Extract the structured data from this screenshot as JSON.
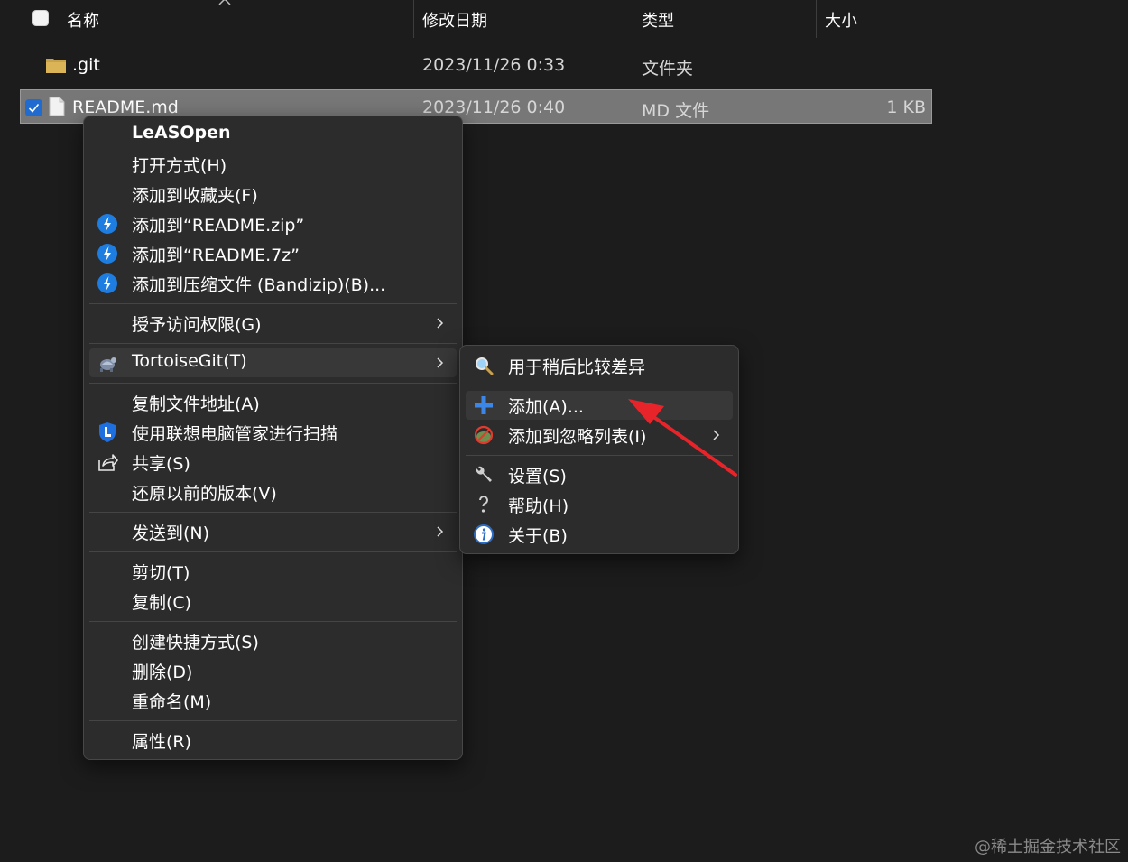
{
  "header": {
    "col_name": "名称",
    "col_date": "修改日期",
    "col_type": "类型",
    "col_size": "大小"
  },
  "files": [
    {
      "name": ".git",
      "date": "2023/11/26 0:33",
      "type": "文件夹",
      "size": ""
    },
    {
      "name": "README.md",
      "date": "2023/11/26 0:40",
      "type": "MD 文件",
      "size": "1 KB"
    }
  ],
  "context_menu": {
    "items": [
      {
        "label": "LeASOpen",
        "icon": ""
      },
      {
        "label": "打开方式(H)",
        "icon": ""
      },
      {
        "label": "添加到收藏夹(F)",
        "icon": ""
      },
      {
        "label": "添加到“README.zip”",
        "icon": "bandizip-icon"
      },
      {
        "label": "添加到“README.7z”",
        "icon": "bandizip-icon"
      },
      {
        "label": "添加到压缩文件 (Bandizip)(B)...",
        "icon": "bandizip-icon"
      },
      {
        "label": "授予访问权限(G)",
        "icon": "",
        "submenu": true
      },
      {
        "label": "TortoiseGit(T)",
        "icon": "tortoisegit-icon",
        "submenu": true
      },
      {
        "label": "复制文件地址(A)",
        "icon": ""
      },
      {
        "label": "使用联想电脑管家进行扫描",
        "icon": "lenovo-shield-icon"
      },
      {
        "label": "共享(S)",
        "icon": "share-icon"
      },
      {
        "label": "还原以前的版本(V)",
        "icon": ""
      },
      {
        "label": "发送到(N)",
        "icon": "",
        "submenu": true
      },
      {
        "label": "剪切(T)",
        "icon": ""
      },
      {
        "label": "复制(C)",
        "icon": ""
      },
      {
        "label": "创建快捷方式(S)",
        "icon": ""
      },
      {
        "label": "删除(D)",
        "icon": ""
      },
      {
        "label": "重命名(M)",
        "icon": ""
      },
      {
        "label": "属性(R)",
        "icon": ""
      }
    ]
  },
  "tortoise_submenu": {
    "items": [
      {
        "label": "用于稍后比较差异",
        "icon": "magnifier-icon"
      },
      {
        "label": "添加(A)...",
        "icon": "plus-icon"
      },
      {
        "label": "添加到忽略列表(I)",
        "icon": "ignore-icon",
        "submenu": true
      },
      {
        "label": "设置(S)",
        "icon": "wrench-icon"
      },
      {
        "label": "帮助(H)",
        "icon": "help-icon"
      },
      {
        "label": "关于(B)",
        "icon": "info-icon"
      }
    ]
  },
  "watermark": "@稀土掘金技术社区",
  "colors": {
    "background": "#1c1c1c",
    "menu_bg": "#2c2c2c",
    "selection": "#777777",
    "accent_blue": "#1f6bd0",
    "annotation_red": "#e8242b"
  }
}
